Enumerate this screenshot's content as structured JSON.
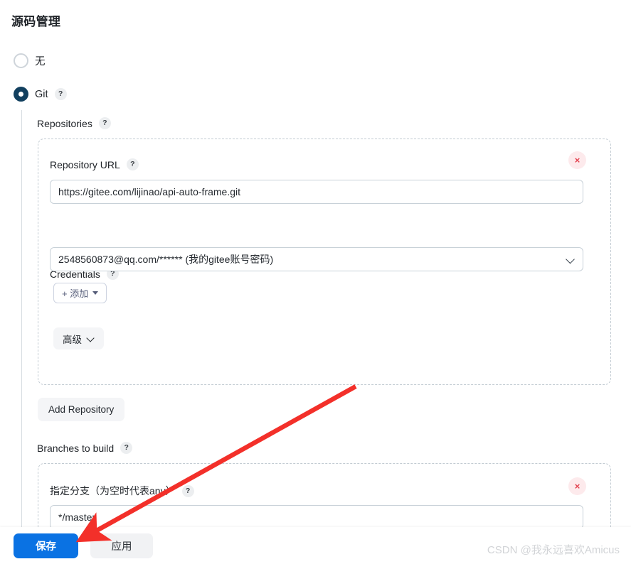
{
  "page": {
    "title": "源码管理"
  },
  "scm_options": [
    {
      "label": "无",
      "selected": false,
      "has_help": false
    },
    {
      "label": "Git",
      "selected": true,
      "has_help": true
    }
  ],
  "git": {
    "repositories_label": "Repositories",
    "repository": {
      "url_label": "Repository URL",
      "url_value": "https://gitee.com/lijinao/api-auto-frame.git",
      "credentials_label": "Credentials",
      "credentials_value": "2548560873@qq.com/****** (我的gitee账号密码)",
      "add_credential_label": "+ 添加",
      "advanced_label": "高级",
      "delete_label": "×"
    },
    "add_repository_label": "Add Repository",
    "branches": {
      "section_label": "Branches to build",
      "spec_label": "指定分支（为空时代表any）",
      "spec_value": "*/master",
      "delete_label": "×"
    },
    "help_glyph": "?"
  },
  "footer": {
    "save_label": "保存",
    "apply_label": "应用"
  },
  "watermark": {
    "text": "CSDN @我永远喜欢Amicus"
  },
  "colors": {
    "primary_button": "#0a72e3",
    "radio_selected": "#12405f",
    "delete_icon": "#e3424f",
    "delete_bg": "#fdeaec",
    "dashed_border": "#c2cbd2",
    "annotation_arrow": "#f3302a"
  }
}
